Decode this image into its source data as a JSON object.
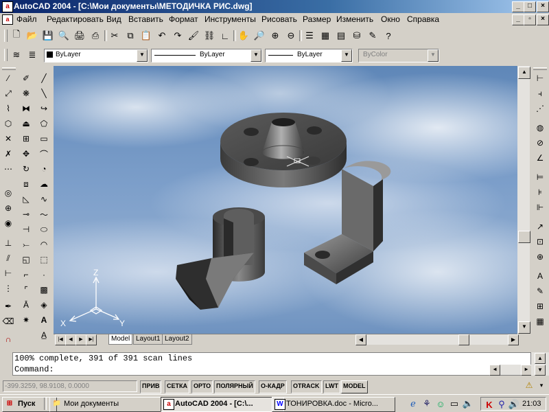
{
  "window": {
    "title": "AutoCAD 2004 - [C:\\Мои документы\\МЕТОДИЧКА РИС.dwg]"
  },
  "menu": [
    "Файл",
    "Редактировать",
    "Вид",
    "Вставить",
    "Формат",
    "Инструменты",
    "Рисовать",
    "Размер",
    "Изменить",
    "Окно",
    "Справка"
  ],
  "properties": {
    "color": "ByLayer",
    "linetype": "ByLayer",
    "lineweight": "ByLayer",
    "plotstyle": "ByColor"
  },
  "ucs": {
    "x": "X",
    "y": "Y",
    "z": "Z"
  },
  "tabs": [
    "Model",
    "Layout1",
    "Layout2"
  ],
  "command": {
    "history": "100% complete, 391 of 391 scan lines",
    "prompt": "Command:"
  },
  "status": {
    "coords": "-399.3259, 98.9108, 0.0000",
    "toggles": [
      "ПРИВ",
      "СЕТКА",
      "ОРТО",
      "ПОЛЯРНЫЙ",
      "О-КАДР",
      "OTRACK",
      "LWT",
      "MODEL"
    ]
  },
  "taskbar": {
    "start": "Пуск",
    "tasks": [
      "Мои документы",
      "AutoCAD 2004 - [C:\\...",
      "ТОНИРОВКА.doc - Micro..."
    ],
    "clock": "21:03"
  },
  "colors": {
    "title_start": "#0a246a",
    "title_end": "#a6caf0",
    "sky": "#7d9fca",
    "face": "#d4d0c8"
  }
}
